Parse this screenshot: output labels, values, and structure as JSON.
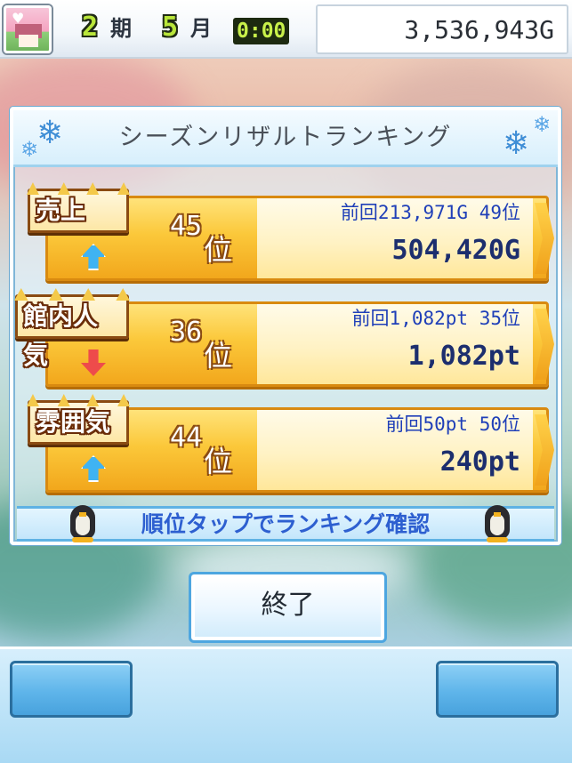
{
  "status": {
    "term_num": "2",
    "term_unit": "期",
    "month_num": "5",
    "month_unit": "月",
    "time": "0:00",
    "money": "3,536,943G"
  },
  "panel": {
    "title": "シーズンリザルトランキング"
  },
  "rankings": [
    {
      "label": "売上",
      "rank": "45",
      "rank_suffix": "位",
      "trend": "up",
      "previous": "前回213,971G 49位",
      "current": "504,420G"
    },
    {
      "label": "館内人気",
      "rank": "36",
      "rank_suffix": "位",
      "trend": "down",
      "previous": "前回1,082pt 35位",
      "current": "1,082pt"
    },
    {
      "label": "雰囲気",
      "rank": "44",
      "rank_suffix": "位",
      "trend": "up",
      "previous": "前回50pt 50位",
      "current": "240pt"
    }
  ],
  "hint": "順位タップでランキング確認",
  "buttons": {
    "end_label": "終了"
  },
  "colors": {
    "accent_blue": "#2d5fd0",
    "gold_band": "#fbc83a",
    "trend_up": "#3fb3f2",
    "trend_down": "#ee4b4b"
  },
  "icons": {
    "trend_up": "arrow-up-icon",
    "trend_down": "arrow-down-icon",
    "decor": "snowflake-icon",
    "mascot": "penguin-icon"
  }
}
